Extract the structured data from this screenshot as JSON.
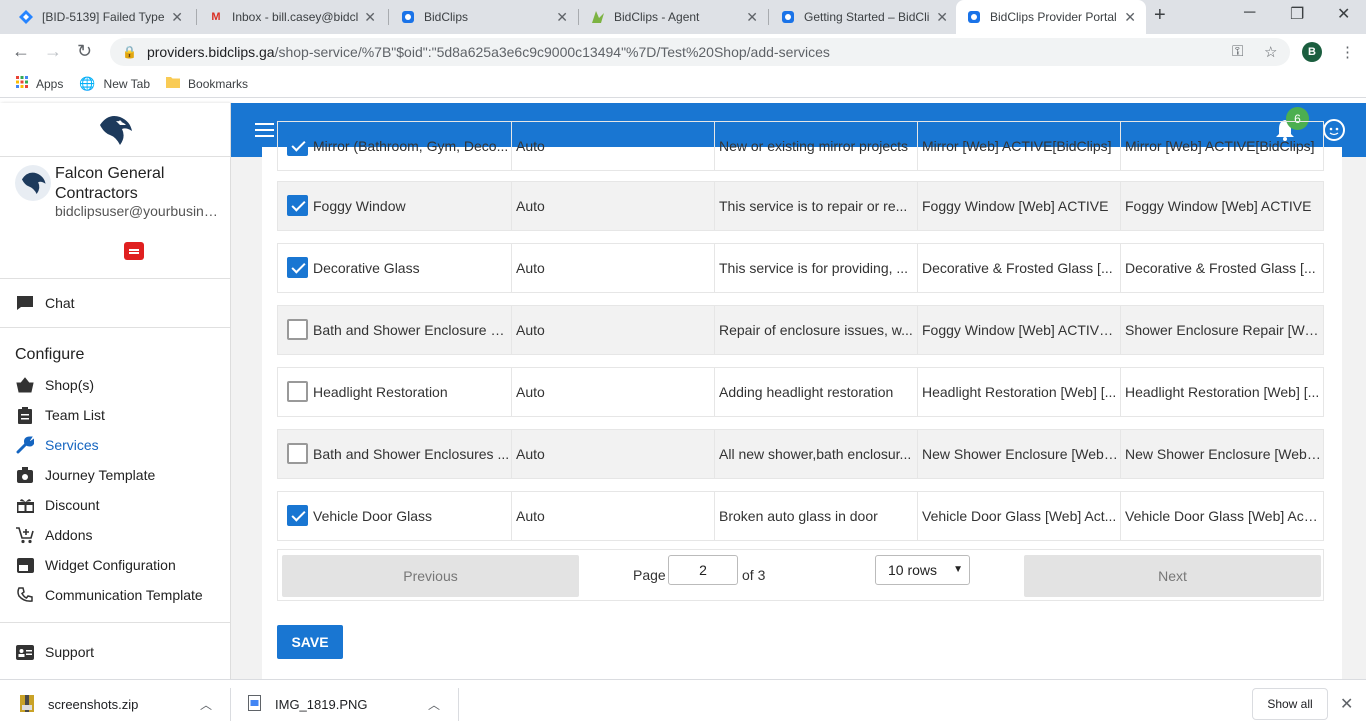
{
  "browser": {
    "tabs": [
      {
        "title": "[BID-5139] Failed TypeE",
        "icon": "jira-icon"
      },
      {
        "title": "Inbox - bill.casey@bidcl",
        "icon": "gmail-icon"
      },
      {
        "title": "BidClips",
        "icon": "bidclips-icon"
      },
      {
        "title": "BidClips - Agent",
        "icon": "agent-icon"
      },
      {
        "title": "Getting Started – BidCli",
        "icon": "bidclips-icon"
      },
      {
        "title": "BidClips Provider Portal",
        "icon": "bidclips-icon"
      }
    ],
    "url_host": "providers.bidclips.ga",
    "url_path": "/shop-service/%7B\"$oid\":\"5d8a625a3e6c9c9000c13494\"%7D/Test%20Shop/add-services",
    "profile_initial": "B",
    "bookmarks": [
      {
        "label": "Apps"
      },
      {
        "label": "New Tab"
      },
      {
        "label": "Bookmarks"
      }
    ]
  },
  "sidebar": {
    "company_name": "Falcon General Contractors",
    "email": "bidclipsuser@yourbusiness.com",
    "chat_label": "Chat",
    "section_title": "Configure",
    "items": [
      {
        "label": "Shop(s)",
        "icon": "shop-basket-icon",
        "active": false
      },
      {
        "label": "Team List",
        "icon": "clipboard-icon",
        "active": false
      },
      {
        "label": "Services",
        "icon": "wrench-icon",
        "active": true
      },
      {
        "label": "Journey Template",
        "icon": "camera-icon",
        "active": false
      },
      {
        "label": "Discount",
        "icon": "gift-icon",
        "active": false
      },
      {
        "label": "Addons",
        "icon": "cart-add-icon",
        "active": false
      },
      {
        "label": "Widget Configuration",
        "icon": "widget-icon",
        "active": false
      },
      {
        "label": "Communication Template",
        "icon": "phone-icon",
        "active": false
      }
    ],
    "support_label": "Support"
  },
  "header": {
    "notification_count": "6"
  },
  "services": {
    "rows": [
      {
        "checked": true,
        "name": "Mirror (Bathroom, Gym, Deco...",
        "mode": "Auto",
        "description": "New or existing mirror projects",
        "web_service": "Mirror [Web] ACTIVE[BidClips]",
        "bidclips_service": "Mirror [Web] ACTIVE[BidClips]"
      },
      {
        "checked": true,
        "name": "Foggy Window",
        "mode": "Auto",
        "description": "This service is to repair or re...",
        "web_service": "Foggy Window [Web] ACTIVE",
        "bidclips_service": "Foggy Window [Web] ACTIVE"
      },
      {
        "checked": true,
        "name": "Decorative Glass",
        "mode": "Auto",
        "description": "This service is for providing, ...",
        "web_service": "Decorative & Frosted Glass [...",
        "bidclips_service": "Decorative & Frosted Glass [..."
      },
      {
        "checked": false,
        "name": "Bath and Shower Enclosure R...",
        "mode": "Auto",
        "description": "Repair of enclosure issues, w...",
        "web_service": "Foggy Window [Web] ACTIVE...",
        "bidclips_service": "Shower Enclosure Repair [We..."
      },
      {
        "checked": false,
        "name": "Headlight Restoration",
        "mode": "Auto",
        "description": "Adding headlight restoration",
        "web_service": "Headlight Restoration [Web] [...",
        "bidclips_service": "Headlight Restoration [Web] [..."
      },
      {
        "checked": false,
        "name": "Bath and Shower Enclosures ...",
        "mode": "Auto",
        "description": "All new shower,bath enclosur...",
        "web_service": "New Shower Enclosure [Web]...",
        "bidclips_service": "New Shower Enclosure [Web]..."
      },
      {
        "checked": true,
        "name": "Vehicle Door Glass",
        "mode": "Auto",
        "description": "Broken auto glass in door",
        "web_service": "Vehicle Door Glass [Web] Act...",
        "bidclips_service": "Vehicle Door Glass [Web] Acti..."
      }
    ],
    "pagination": {
      "previous_label": "Previous",
      "next_label": "Next",
      "page_label": "Page",
      "page_value": "2",
      "of_label": "of 3",
      "rows_label": "10 rows"
    },
    "save_label": "SAVE"
  },
  "downloads": {
    "items": [
      {
        "name": "screenshots.zip",
        "icon": "zip-file-icon"
      },
      {
        "name": "IMG_1819.PNG",
        "icon": "image-file-icon"
      }
    ],
    "show_all_label": "Show all"
  }
}
